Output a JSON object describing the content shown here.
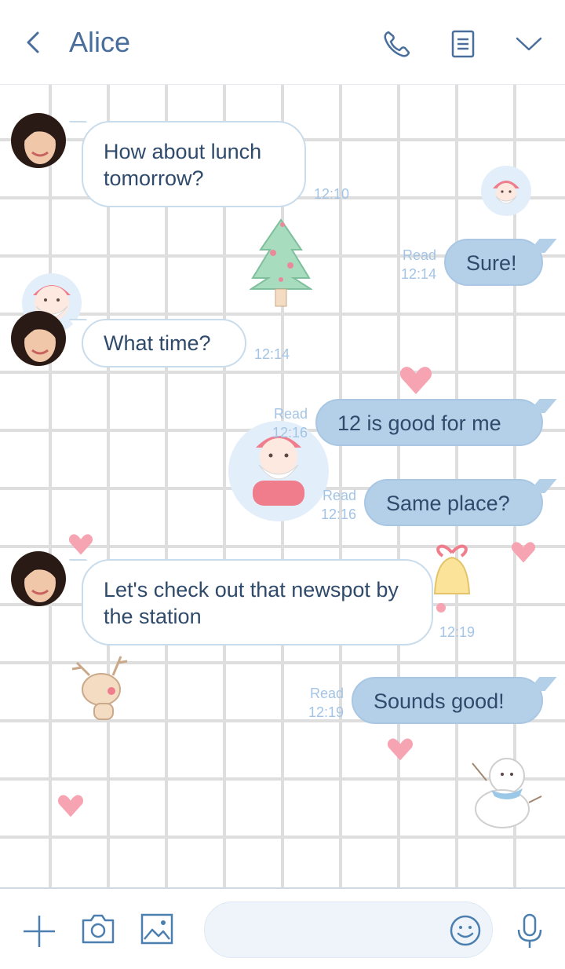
{
  "header": {
    "title": "Alice",
    "icons": [
      "back-chevron-icon",
      "phone-icon",
      "notes-icon",
      "chevron-down-icon"
    ]
  },
  "messages": [
    {
      "id": 1,
      "from": "Alice",
      "direction": "incoming",
      "text": "How about lunch tomorrow?",
      "time": "12:10"
    },
    {
      "id": 2,
      "from": "me",
      "direction": "outgoing",
      "text": "Sure!",
      "status": "Read",
      "time": "12:14"
    },
    {
      "id": 3,
      "from": "Alice",
      "direction": "incoming",
      "text": "What time?",
      "time": "12:14"
    },
    {
      "id": 4,
      "from": "me",
      "direction": "outgoing",
      "text": "12 is good for me",
      "status": "Read",
      "time": "12:16"
    },
    {
      "id": 5,
      "from": "me",
      "direction": "outgoing",
      "text": "Same place?",
      "status": "Read",
      "time": "12:16"
    },
    {
      "id": 6,
      "from": "Alice",
      "direction": "incoming",
      "text": "Let's check out that newspot by the station",
      "time": "12:19"
    },
    {
      "id": 7,
      "from": "me",
      "direction": "outgoing",
      "text": "Sounds good!",
      "status": "Read",
      "time": "12:19"
    }
  ],
  "input": {
    "value": "",
    "icons": [
      "plus-icon",
      "camera-icon",
      "image-icon",
      "emoji-icon",
      "microphone-icon"
    ]
  },
  "theme": {
    "accent": "#4a6e9c",
    "outgoing_bubble": "#b4cfe8",
    "incoming_bubble": "#ffffff",
    "meta_text": "#a3c4e4",
    "grid_line": "#dedede"
  }
}
